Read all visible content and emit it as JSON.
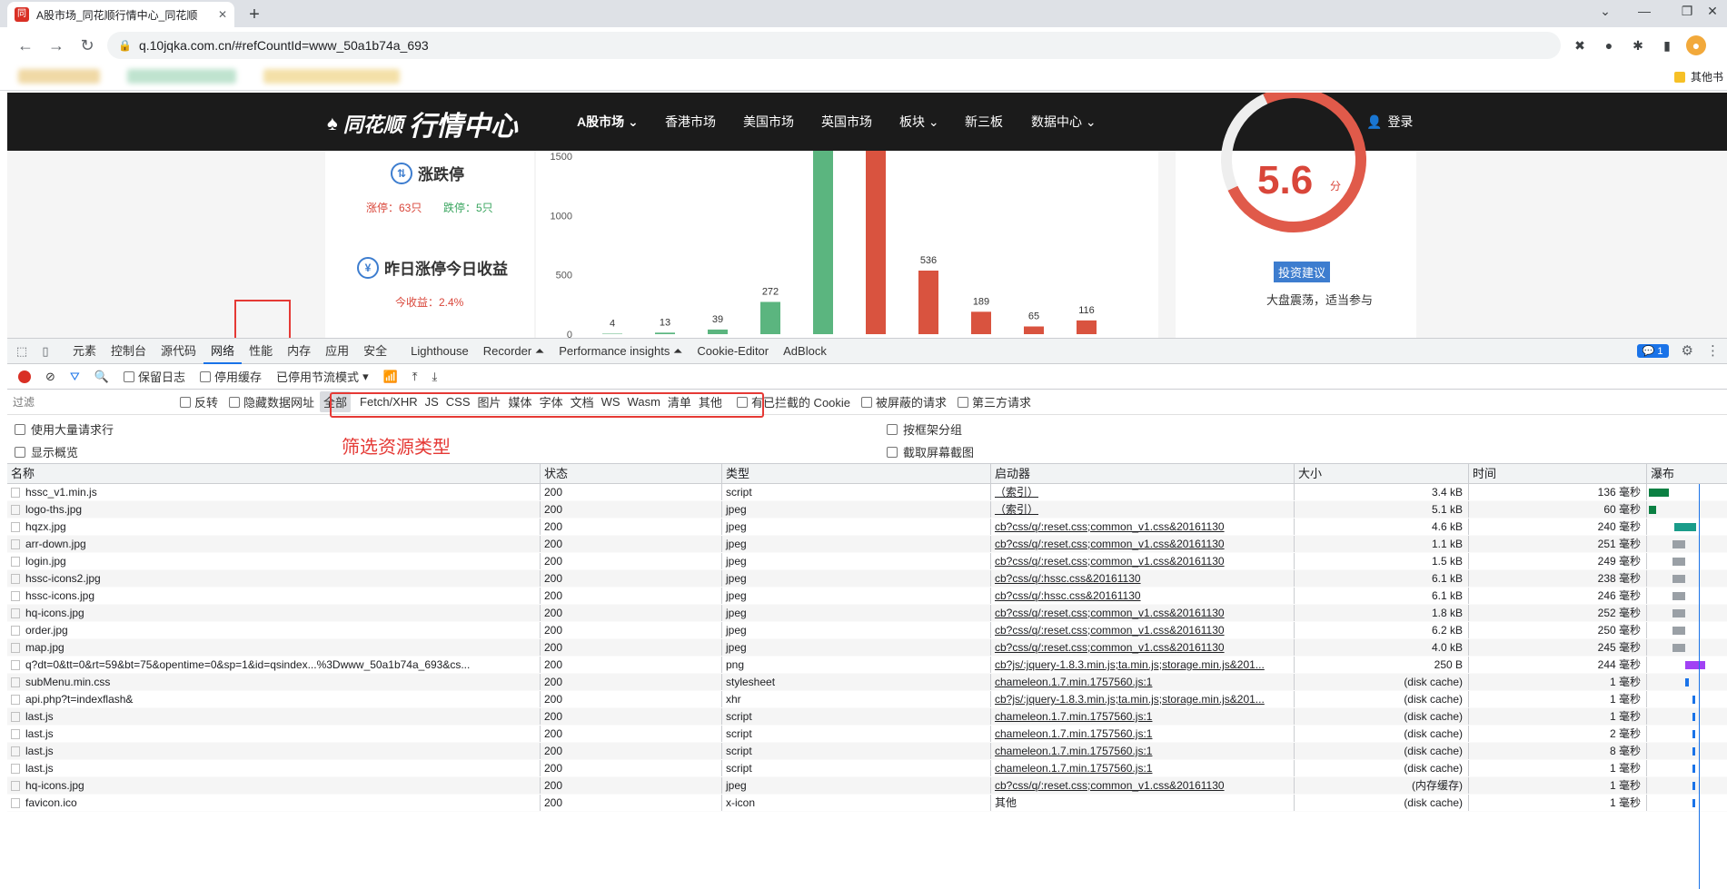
{
  "browser": {
    "tab_title": "A股市场_同花顺行情中心_同花顺",
    "url": "q.10jqka.com.cn/#refCountId=www_50a1b74a_693",
    "other_bookmarks": "其他书"
  },
  "site": {
    "logo_main": "同花顺",
    "logo_sub": "行情中心",
    "nav": [
      "A股市场 ⌄",
      "香港市场",
      "美国市场",
      "英国市场",
      "板块 ⌄",
      "新三板",
      "数据中心 ⌄"
    ],
    "login": "登录",
    "limit_title": "涨跌停",
    "limit_up": "涨停：63只",
    "limit_down": "跌停：5只",
    "yesterday_title": "昨日涨停今日收益",
    "today_gain": "今收益：2.4%",
    "score": "5.6",
    "score_unit": "分",
    "advice": "投资建议",
    "market_state": "大盘震荡，适当参与"
  },
  "chart_data": {
    "type": "bar",
    "y_ticks": [
      "1500",
      "1000",
      "500",
      "0"
    ],
    "ylim": [
      0,
      1700
    ],
    "bars": [
      {
        "label": "4",
        "value": 4,
        "color": "#5bb57f"
      },
      {
        "label": "13",
        "value": 13,
        "color": "#5bb57f"
      },
      {
        "label": "39",
        "value": 39,
        "color": "#5bb57f"
      },
      {
        "label": "272",
        "value": 272,
        "color": "#5bb57f"
      },
      {
        "label": "",
        "value": 1700,
        "color": "#5bb57f"
      },
      {
        "label": "",
        "value": 1700,
        "color": "#d9533f"
      },
      {
        "label": "536",
        "value": 536,
        "color": "#d9533f"
      },
      {
        "label": "189",
        "value": 189,
        "color": "#d9533f"
      },
      {
        "label": "65",
        "value": 65,
        "color": "#d9533f"
      },
      {
        "label": "116",
        "value": 116,
        "color": "#d9533f"
      }
    ]
  },
  "devtools": {
    "tabs": [
      "元素",
      "控制台",
      "源代码",
      "网络",
      "性能",
      "内存",
      "应用",
      "安全",
      "Lighthouse",
      "Recorder ⏶",
      "Performance insights ⏶",
      "Cookie-Editor",
      "AdBlock"
    ],
    "messages": "1",
    "preserve_log": "保留日志",
    "disable_cache": "停用缓存",
    "throttle": "已停用节流模式",
    "filter_placeholder": "过滤",
    "invert": "反转",
    "hide_data_urls": "隐藏数据网址",
    "types": [
      "全部",
      "Fetch/XHR",
      "JS",
      "CSS",
      "图片",
      "媒体",
      "字体",
      "文档",
      "WS",
      "Wasm",
      "清单",
      "其他"
    ],
    "blocked_cookies": "有已拦截的 Cookie",
    "blocked_requests": "被屏蔽的请求",
    "third_party": "第三方请求",
    "big_rows": "使用大量请求行",
    "overview": "显示概览",
    "group_frame": "按框架分组",
    "screenshots": "截取屏幕截图",
    "annotation": "筛选资源类型",
    "columns": [
      "名称",
      "状态",
      "类型",
      "启动器",
      "大小",
      "时间",
      "瀑布"
    ],
    "rows": [
      {
        "name": "hssc_v1.min.js",
        "status": "200",
        "type": "script",
        "initiator": "（索引）",
        "size": "3.4 kB",
        "time": "136 毫秒"
      },
      {
        "name": "logo-ths.jpg",
        "status": "200",
        "type": "jpeg",
        "initiator": "（索引）",
        "size": "5.1 kB",
        "time": "60 毫秒"
      },
      {
        "name": "hqzx.jpg",
        "status": "200",
        "type": "jpeg",
        "initiator": "cb?css/q/:reset.css;common_v1.css&20161130",
        "size": "4.6 kB",
        "time": "240 毫秒"
      },
      {
        "name": "arr-down.jpg",
        "status": "200",
        "type": "jpeg",
        "initiator": "cb?css/q/:reset.css;common_v1.css&20161130",
        "size": "1.1 kB",
        "time": "251 毫秒"
      },
      {
        "name": "login.jpg",
        "status": "200",
        "type": "jpeg",
        "initiator": "cb?css/q/:reset.css;common_v1.css&20161130",
        "size": "1.5 kB",
        "time": "249 毫秒"
      },
      {
        "name": "hssc-icons2.jpg",
        "status": "200",
        "type": "jpeg",
        "initiator": "cb?css/q/:hssc.css&20161130",
        "size": "6.1 kB",
        "time": "238 毫秒"
      },
      {
        "name": "hssc-icons.jpg",
        "status": "200",
        "type": "jpeg",
        "initiator": "cb?css/q/:hssc.css&20161130",
        "size": "6.1 kB",
        "time": "246 毫秒"
      },
      {
        "name": "hq-icons.jpg",
        "status": "200",
        "type": "jpeg",
        "initiator": "cb?css/q/:reset.css;common_v1.css&20161130",
        "size": "1.8 kB",
        "time": "252 毫秒"
      },
      {
        "name": "order.jpg",
        "status": "200",
        "type": "jpeg",
        "initiator": "cb?css/q/:reset.css;common_v1.css&20161130",
        "size": "6.2 kB",
        "time": "250 毫秒"
      },
      {
        "name": "map.jpg",
        "status": "200",
        "type": "jpeg",
        "initiator": "cb?css/q/:reset.css;common_v1.css&20161130",
        "size": "4.0 kB",
        "time": "245 毫秒"
      },
      {
        "name": "q?dt=0&tt=0&rt=59&bt=75&opentime=0&sp=1&id=qsindex...%3Dwww_50a1b74a_693&cs...",
        "status": "200",
        "type": "png",
        "initiator": "cb?js/:jquery-1.8.3.min.js;ta.min.js;storage.min.js&201...",
        "size": "250 B",
        "time": "244 毫秒"
      },
      {
        "name": "subMenu.min.css",
        "status": "200",
        "type": "stylesheet",
        "initiator": "chameleon.1.7.min.1757560.js:1",
        "size": "(disk cache)",
        "time": "1 毫秒"
      },
      {
        "name": "api.php?t=indexflash&",
        "status": "200",
        "type": "xhr",
        "initiator": "cb?js/:jquery-1.8.3.min.js;ta.min.js;storage.min.js&201...",
        "size": "(disk cache)",
        "time": "1 毫秒"
      },
      {
        "name": "last.js",
        "status": "200",
        "type": "script",
        "initiator": "chameleon.1.7.min.1757560.js:1",
        "size": "(disk cache)",
        "time": "1 毫秒"
      },
      {
        "name": "last.js",
        "status": "200",
        "type": "script",
        "initiator": "chameleon.1.7.min.1757560.js:1",
        "size": "(disk cache)",
        "time": "2 毫秒"
      },
      {
        "name": "last.js",
        "status": "200",
        "type": "script",
        "initiator": "chameleon.1.7.min.1757560.js:1",
        "size": "(disk cache)",
        "time": "8 毫秒"
      },
      {
        "name": "last.js",
        "status": "200",
        "type": "script",
        "initiator": "chameleon.1.7.min.1757560.js:1",
        "size": "(disk cache)",
        "time": "1 毫秒"
      },
      {
        "name": "hq-icons.jpg",
        "status": "200",
        "type": "jpeg",
        "initiator": "cb?css/q/:reset.css;common_v1.css&20161130",
        "size": "(内存缓存)",
        "time": "1 毫秒"
      },
      {
        "name": "favicon.ico",
        "status": "200",
        "type": "x-icon",
        "initiator": "其他",
        "size": "(disk cache)",
        "time": "1 毫秒"
      }
    ]
  }
}
